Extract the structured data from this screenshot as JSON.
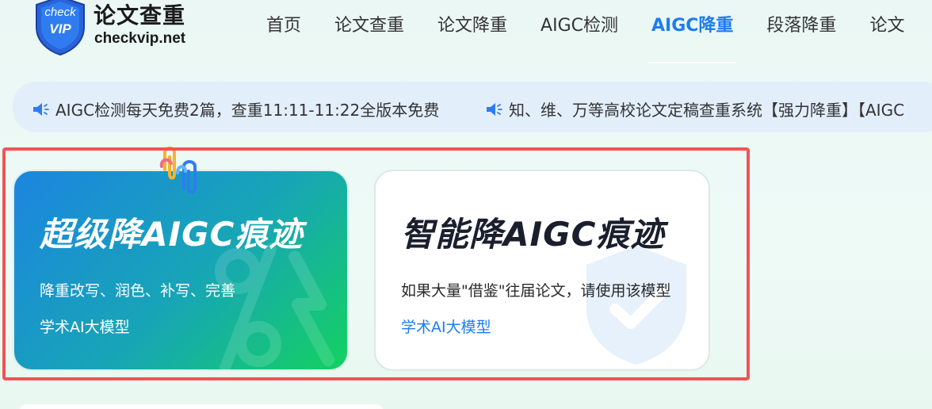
{
  "logo": {
    "badge_line1": "check",
    "badge_line2": "VIP",
    "brand_cn": "论文查重",
    "brand_en": "checkvip.net"
  },
  "nav": {
    "items": [
      {
        "label": "首页"
      },
      {
        "label": "论文查重"
      },
      {
        "label": "论文降重"
      },
      {
        "label": "AIGC检测"
      },
      {
        "label": "AIGC降重"
      },
      {
        "label": "段落降重"
      },
      {
        "label": "论文"
      }
    ],
    "active": "AIGC降重"
  },
  "notices": [
    {
      "text": "AIGC检测每天免费2篇，查重11:11-11:22全版本免费"
    },
    {
      "text": "知、维、万等高校论文定稿查重系统【强力降重】【AIGC"
    }
  ],
  "cards": [
    {
      "title": "超级降AIGC痕迹",
      "desc": "降重改写、润色、补写、完善",
      "sub": "学术AI大模型"
    },
    {
      "title": "智能降AIGC痕迹",
      "desc": "如果大量\"借鉴\"往届论文，请使用该模型",
      "sub": "学术AI大模型"
    }
  ],
  "colors": {
    "accent": "#1e7cf0",
    "highlight_border": "#f05454",
    "card1_gradient_start": "#1c85e0",
    "card1_gradient_end": "#14d160",
    "notice_bg": "#e3eefb"
  },
  "icons": {
    "notice": "speaker-icon",
    "logo": "shield-logo-icon",
    "card_decoration": "paperclip-icon"
  }
}
